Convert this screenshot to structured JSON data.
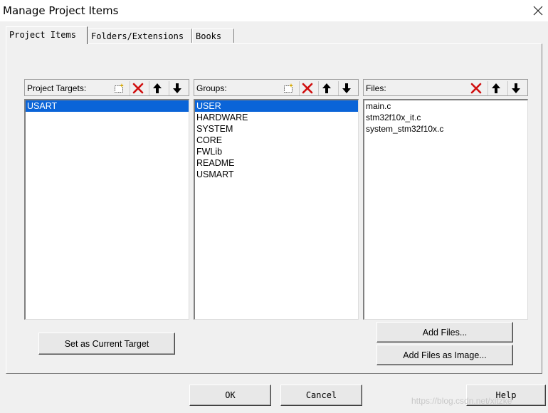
{
  "window": {
    "title": "Manage Project Items"
  },
  "tabs": [
    {
      "label": "Project Items",
      "active": true
    },
    {
      "label": "Folders/Extensions",
      "active": false
    },
    {
      "label": "Books",
      "active": false
    }
  ],
  "targets": {
    "label": "Project Targets:",
    "items": [
      "USART"
    ],
    "selected": "USART"
  },
  "groups": {
    "label": "Groups:",
    "items": [
      "USER",
      "HARDWARE",
      "SYSTEM",
      "CORE",
      "FWLib",
      "README",
      "USMART"
    ],
    "selected": "USER"
  },
  "files": {
    "label": "Files:",
    "items": [
      "main.c",
      "stm32f10x_it.c",
      "system_stm32f10x.c"
    ]
  },
  "buttons": {
    "set_current_target": "Set as Current Target",
    "add_files": "Add Files...",
    "add_files_as_image": "Add Files as Image...",
    "ok": "OK",
    "cancel": "Cancel",
    "help": "Help"
  },
  "watermark": "https://blog.csdn.net/xitzke",
  "colors": {
    "selection": "#0a64d8",
    "delete_red": "#d01010"
  },
  "icons": [
    "new-item-icon",
    "delete-icon",
    "move-up-icon",
    "move-down-icon",
    "close-icon"
  ]
}
